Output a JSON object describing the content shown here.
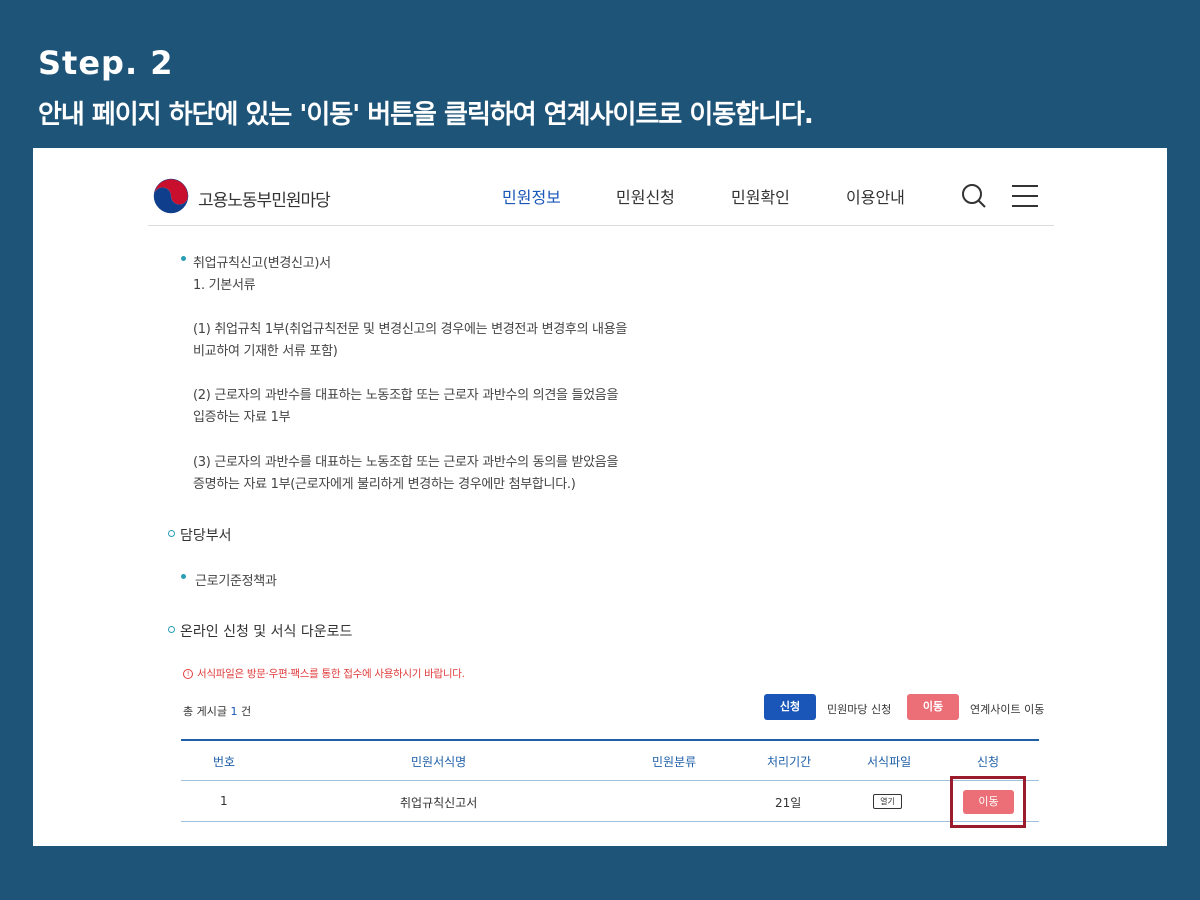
{
  "step": {
    "title": "Step. 2",
    "description": "안내 페이지 하단에 있는 '이동' 버튼을 클릭하여 연계사이트로 이동합니다."
  },
  "site": {
    "name": "고용노동부민원마당",
    "nav": [
      "민원정보",
      "민원신청",
      "민원확인",
      "이용안내"
    ],
    "active_nav": "민원정보",
    "icons": [
      "search-icon",
      "menu-icon",
      "government-logo"
    ]
  },
  "documents": {
    "heading": "취업규칙신고(변경신고)서",
    "subheading": "1. 기본서류",
    "items": [
      {
        "line1": "(1) 취업규칙 1부(취업규칙전문 및 변경신고의 경우에는 변경전과 변경후의 내용을",
        "line2": "비교하여 기재한 서류 포함)"
      },
      {
        "line1": "(2) 근로자의 과반수를 대표하는 노동조합 또는 근로자 과반수의 의견을 들었음을",
        "line2": "입증하는 자료 1부"
      },
      {
        "line1": "(3) 근로자의 과반수를 대표하는 노동조합 또는 근로자 과반수의 동의를 받았음을",
        "line2": "증명하는 자료 1부(근로자에게 불리하게 변경하는 경우에만 첨부합니다.)"
      }
    ]
  },
  "department": {
    "title": "담당부서",
    "name": "근로기준정책과"
  },
  "online": {
    "title": "온라인 신청 및 서식 다운로드",
    "notice": "서식파일은 방문·우편·팩스를 통한 접수에 사용하시기 바랍니다.",
    "notice_icon": "!",
    "total_prefix": "총 게시글",
    "total_count": "1",
    "total_suffix": "건",
    "legend": {
      "apply_btn": "신청",
      "apply_txt": "민원마당 신청",
      "move_btn": "이동",
      "move_txt": "연계사이트 이동"
    }
  },
  "table": {
    "headers": [
      "번호",
      "민원서식명",
      "민원분류",
      "처리기간",
      "서식파일",
      "신청"
    ],
    "row": {
      "no": "1",
      "name": "취업규칙신고서",
      "category": "",
      "period": "21일",
      "file_btn": "열기",
      "action_btn": "이동"
    }
  },
  "colors": {
    "background": "#1e5478",
    "primary": "#1a56b8",
    "move": "#ec6f78",
    "highlight": "#9a1c2c",
    "accent": "#2a9fb4"
  }
}
